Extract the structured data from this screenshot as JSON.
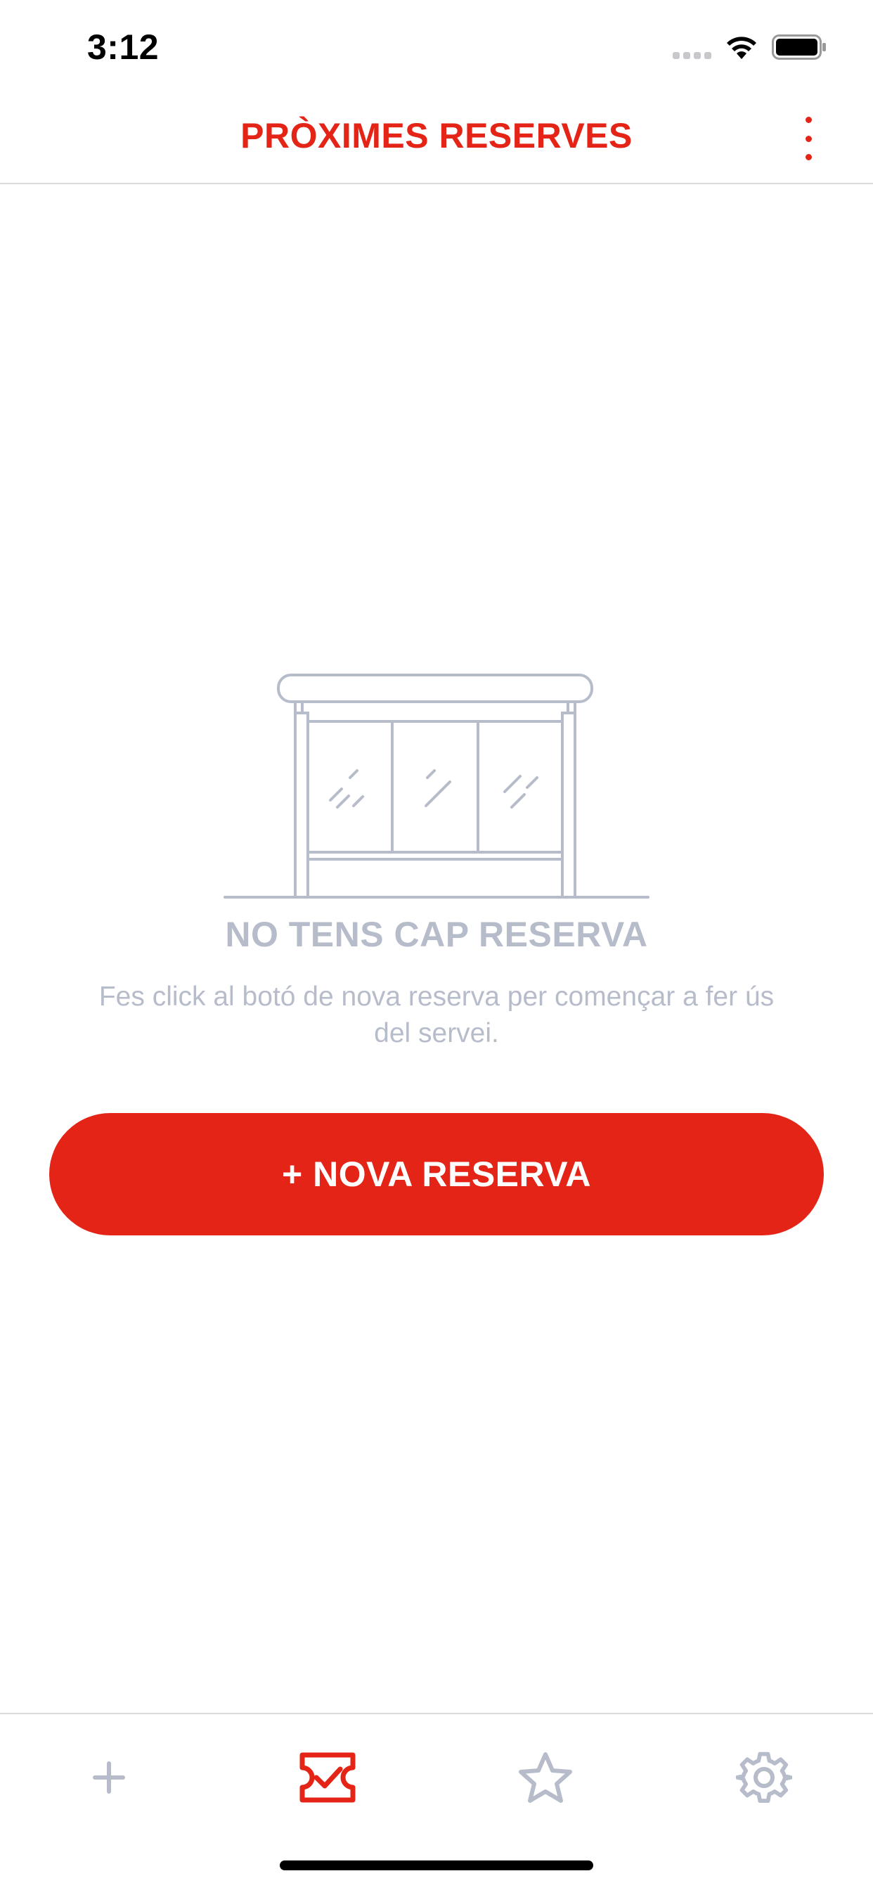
{
  "status_bar": {
    "time": "3:12",
    "signal_icon": "cellular-signal-icon",
    "wifi_icon": "wifi-icon",
    "battery_icon": "battery-icon"
  },
  "header": {
    "title": "PRÒXIMES RESERVES",
    "menu_icon": "more-vertical-icon"
  },
  "empty_state": {
    "illustration": "bus-stop-shelter",
    "title": "NO TENS CAP RESERVA",
    "message": "Fes click al botó de nova reserva per començar a fer ús del servei."
  },
  "primary_action": {
    "label": "+ NOVA RESERVA"
  },
  "tab_bar": {
    "tabs": [
      {
        "icon": "plus-icon",
        "active": false
      },
      {
        "icon": "ticket-check-icon",
        "active": true
      },
      {
        "icon": "star-icon",
        "active": false
      },
      {
        "icon": "gear-icon",
        "active": false
      }
    ]
  },
  "colors": {
    "accent": "#e32416",
    "muted": "#b6bcca",
    "divider": "#d9d9de",
    "icon_inactive": "#b6bcca"
  }
}
